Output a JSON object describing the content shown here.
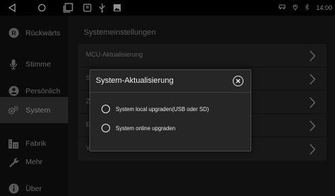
{
  "statusbar": {
    "nav_icons": [
      "back-triangle-icon",
      "home-circle-icon",
      "recents-square-icon"
    ],
    "notification_icons": [
      "screenshot-icon",
      "usb-icon",
      "image-icon"
    ],
    "right_icons": [
      "car-link-icon",
      "location-icon",
      "bluetooth-icon"
    ],
    "time": "14:00"
  },
  "sidebar": {
    "items": [
      {
        "label": "Rückwärts",
        "icon": "reverse-r-icon",
        "active": false
      },
      {
        "label": "Stimme",
        "icon": "microphone-icon",
        "active": false
      },
      {
        "label": "Persönlich",
        "icon": "person-icon",
        "active": false
      },
      {
        "label": "System",
        "icon": "gears-icon",
        "active": true
      },
      {
        "label": "Fabrik",
        "icon": "factory-icon",
        "active": false
      },
      {
        "label": "Mehr",
        "icon": "wrench-icon",
        "active": false
      },
      {
        "label": "Über",
        "icon": "info-icon",
        "active": false
      }
    ]
  },
  "main": {
    "title": "Systemeinstellungen",
    "rows": [
      {
        "label": "MCU-Aktualisierung"
      },
      {
        "label": "S"
      },
      {
        "label": "Z"
      },
      {
        "label": "E"
      },
      {
        "label": "V"
      }
    ]
  },
  "dialog": {
    "title": "System-Aktualisierung",
    "options": [
      {
        "label": "System local upgraden(USB oder SD)"
      },
      {
        "label": "System online upgraden"
      }
    ]
  },
  "colors": {
    "background": "#000000",
    "sidebar_active": "#3a3a3a",
    "panel": "#262626",
    "text_dim": "#9a9a9a"
  }
}
